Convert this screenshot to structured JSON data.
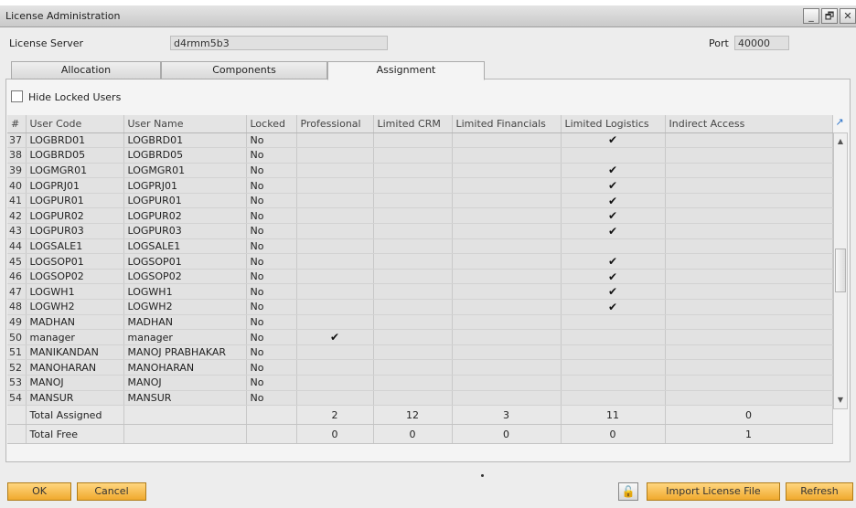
{
  "window": {
    "title": "License Administration",
    "controls": [
      "_",
      "🗗",
      "✕"
    ]
  },
  "server": {
    "label": "License Server",
    "value": "d4rmm5b3",
    "port_label": "Port",
    "port_value": "40000"
  },
  "tabs": [
    {
      "label": "Allocation",
      "active": false
    },
    {
      "label": "Components",
      "active": false
    },
    {
      "label": "Assignment",
      "active": true
    }
  ],
  "filter": {
    "hide_locked_label": "Hide Locked Users",
    "checked": false
  },
  "grid": {
    "columns": [
      "#",
      "User Code",
      "User Name",
      "Locked",
      "Professional",
      "Limited CRM",
      "Limited Financials",
      "Limited Logistics",
      "Indirect Access"
    ],
    "check_glyph": "✔",
    "rows": [
      {
        "num": "37",
        "code": "LOGBRD01",
        "name": "LOGBRD01",
        "locked": "No",
        "pro": false,
        "crm": false,
        "fin": false,
        "log": true,
        "ind": false
      },
      {
        "num": "38",
        "code": "LOGBRD05",
        "name": "LOGBRD05",
        "locked": "No",
        "pro": false,
        "crm": false,
        "fin": false,
        "log": false,
        "ind": false
      },
      {
        "num": "39",
        "code": "LOGMGR01",
        "name": "LOGMGR01",
        "locked": "No",
        "pro": false,
        "crm": false,
        "fin": false,
        "log": true,
        "ind": false
      },
      {
        "num": "40",
        "code": "LOGPRJ01",
        "name": "LOGPRJ01",
        "locked": "No",
        "pro": false,
        "crm": false,
        "fin": false,
        "log": true,
        "ind": false
      },
      {
        "num": "41",
        "code": "LOGPUR01",
        "name": "LOGPUR01",
        "locked": "No",
        "pro": false,
        "crm": false,
        "fin": false,
        "log": true,
        "ind": false
      },
      {
        "num": "42",
        "code": "LOGPUR02",
        "name": "LOGPUR02",
        "locked": "No",
        "pro": false,
        "crm": false,
        "fin": false,
        "log": true,
        "ind": false
      },
      {
        "num": "43",
        "code": "LOGPUR03",
        "name": "LOGPUR03",
        "locked": "No",
        "pro": false,
        "crm": false,
        "fin": false,
        "log": true,
        "ind": false
      },
      {
        "num": "44",
        "code": "LOGSALE1",
        "name": "LOGSALE1",
        "locked": "No",
        "pro": false,
        "crm": false,
        "fin": false,
        "log": false,
        "ind": false
      },
      {
        "num": "45",
        "code": "LOGSOP01",
        "name": "LOGSOP01",
        "locked": "No",
        "pro": false,
        "crm": false,
        "fin": false,
        "log": true,
        "ind": false
      },
      {
        "num": "46",
        "code": "LOGSOP02",
        "name": "LOGSOP02",
        "locked": "No",
        "pro": false,
        "crm": false,
        "fin": false,
        "log": true,
        "ind": false
      },
      {
        "num": "47",
        "code": "LOGWH1",
        "name": "LOGWH1",
        "locked": "No",
        "pro": false,
        "crm": false,
        "fin": false,
        "log": true,
        "ind": false
      },
      {
        "num": "48",
        "code": "LOGWH2",
        "name": "LOGWH2",
        "locked": "No",
        "pro": false,
        "crm": false,
        "fin": false,
        "log": true,
        "ind": false
      },
      {
        "num": "49",
        "code": "MADHAN",
        "name": "MADHAN",
        "locked": "No",
        "pro": false,
        "crm": false,
        "fin": false,
        "log": false,
        "ind": false
      },
      {
        "num": "50",
        "code": "manager",
        "name": "manager",
        "locked": "No",
        "pro": true,
        "crm": false,
        "fin": false,
        "log": false,
        "ind": false
      },
      {
        "num": "51",
        "code": "MANIKANDAN",
        "name": "MANOJ PRABHAKAR",
        "locked": "No",
        "pro": false,
        "crm": false,
        "fin": false,
        "log": false,
        "ind": false
      },
      {
        "num": "52",
        "code": "MANOHARAN",
        "name": "MANOHARAN",
        "locked": "No",
        "pro": false,
        "crm": false,
        "fin": false,
        "log": false,
        "ind": false
      },
      {
        "num": "53",
        "code": "MANOJ",
        "name": "MANOJ",
        "locked": "No",
        "pro": false,
        "crm": false,
        "fin": false,
        "log": false,
        "ind": false
      },
      {
        "num": "54",
        "code": "MANSUR",
        "name": "MANSUR",
        "locked": "No",
        "pro": false,
        "crm": false,
        "fin": false,
        "log": false,
        "ind": false
      }
    ],
    "totals": [
      {
        "label": "Total Assigned",
        "pro": "2",
        "crm": "12",
        "fin": "3",
        "log": "11",
        "ind": "0"
      },
      {
        "label": "Total Free",
        "pro": "0",
        "crm": "0",
        "fin": "0",
        "log": "0",
        "ind": "1"
      }
    ]
  },
  "footer": {
    "ok_label": "OK",
    "cancel_label": "Cancel",
    "lock_icon": "🔓",
    "import_label": "Import License File",
    "refresh_label": "Refresh"
  },
  "colors": {
    "accent_button": "#f0a92e",
    "expand_arrow": "#2a72c9"
  }
}
